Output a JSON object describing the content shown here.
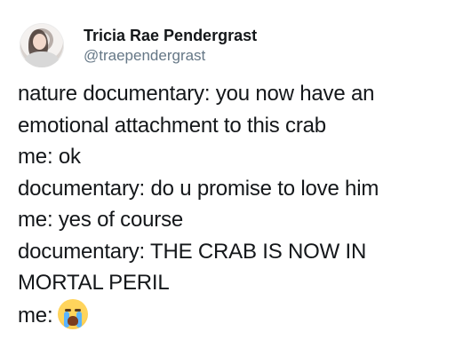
{
  "author": {
    "display_name": "Tricia Rae Pendergrast",
    "handle": "@traependergrast"
  },
  "tweet": {
    "lines": [
      "nature documentary: you now have an",
      "emotional attachment to this crab",
      "me: ok",
      "documentary: do u promise to love him",
      "me: yes of course",
      "documentary: THE CRAB IS NOW IN",
      "MORTAL PERIL",
      "me:"
    ],
    "final_emoji": "loudly-crying-face-icon"
  }
}
